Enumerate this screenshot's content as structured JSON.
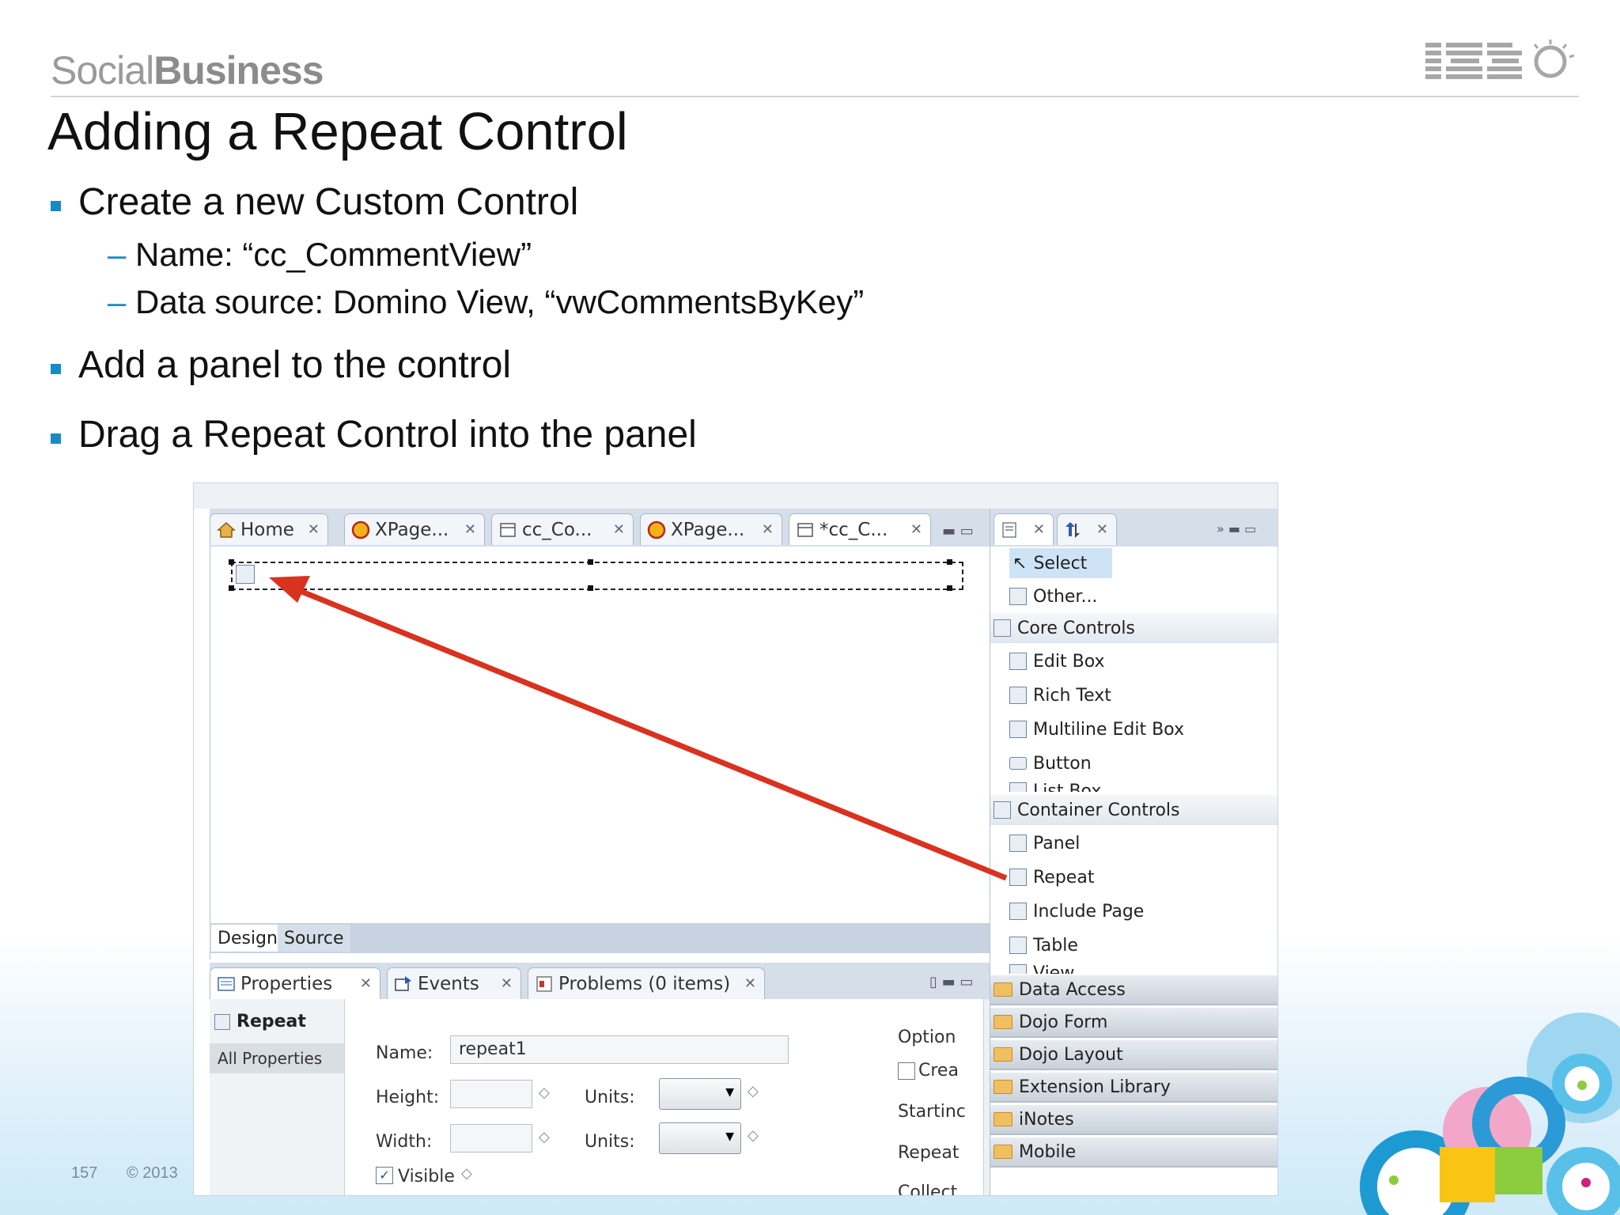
{
  "slide": {
    "brand_light": "Social",
    "brand_bold": "Business",
    "logo_text": "IBM",
    "title": "Adding a Repeat Control",
    "bullets": [
      {
        "text": "Create a new Custom Control",
        "subs": [
          "Name: “cc_CommentView”",
          "Data source: Domino View, “vwCommentsByKey”"
        ]
      },
      {
        "text": "Add a panel to the control"
      },
      {
        "text": "Drag a Repeat Control into the panel"
      }
    ],
    "page_number": "157",
    "copyright": "© 2013",
    "accent_color": "#1a8ac4"
  },
  "screenshot": {
    "editor_tabs": [
      {
        "label": "Home",
        "icon": "home-icon"
      },
      {
        "label": "XPage...",
        "icon": "xpage-icon"
      },
      {
        "label": "cc_Co...",
        "icon": "custom-control-icon"
      },
      {
        "label": "XPage...",
        "icon": "xpage-icon"
      },
      {
        "label": "*cc_C...",
        "icon": "custom-control-icon"
      }
    ],
    "view_tabs": {
      "design": "Design",
      "source": "Source"
    },
    "bottom_tabs": [
      {
        "label": "Properties",
        "icon": "properties-icon"
      },
      {
        "label": "Events",
        "icon": "events-icon"
      },
      {
        "label": "Problems (0 items)",
        "icon": "problems-icon"
      }
    ],
    "properties": {
      "nav_title": "Repeat",
      "nav_all": "All Properties",
      "name_label": "Name:",
      "name_value": "repeat1",
      "height_label": "Height:",
      "width_label": "Width:",
      "units_label": "Units:",
      "visible_label": "Visible",
      "visible_checked": true,
      "options_label": "Option",
      "create_label": "Crea",
      "starting_label": "Startinc",
      "repeat_label": "Repeat",
      "collect_label": "Collect"
    },
    "palette": {
      "select": "Select",
      "other": "Other...",
      "core_header": "Core Controls",
      "core_items": [
        "Edit Box",
        "Rich Text",
        "Multiline Edit Box",
        "Button",
        "List Box"
      ],
      "container_header": "Container Controls",
      "container_items": [
        "Panel",
        "Repeat",
        "Include Page",
        "Table",
        "View"
      ],
      "drawers": [
        "Data Access",
        "Dojo Form",
        "Dojo Layout",
        "Extension Library",
        "iNotes",
        "Mobile"
      ]
    },
    "arrow_color": "#d9321f"
  }
}
